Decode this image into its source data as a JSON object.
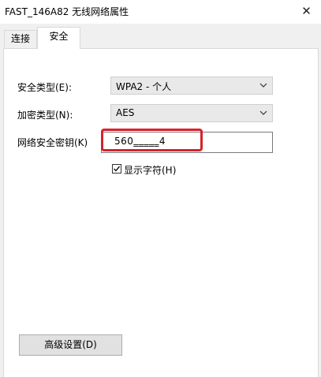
{
  "window": {
    "title": "FAST_146A82 无线网络属性",
    "close_icon": "✕"
  },
  "tabs": [
    {
      "label": "连接",
      "active": false
    },
    {
      "label": "安全",
      "active": true
    }
  ],
  "security": {
    "security_type_label": "安全类型(E):",
    "security_type_value": "WPA2 - 个人",
    "encryption_type_label": "加密类型(N):",
    "encryption_type_value": "AES",
    "key_label": "网络安全密钥(K)",
    "key_value": "560‗‗‗‗‗4",
    "show_chars_label": "显示字符(H)",
    "show_chars_checked": true
  },
  "advanced_button_label": "高级设置(D)",
  "colors": {
    "highlight": "#d7212c"
  }
}
